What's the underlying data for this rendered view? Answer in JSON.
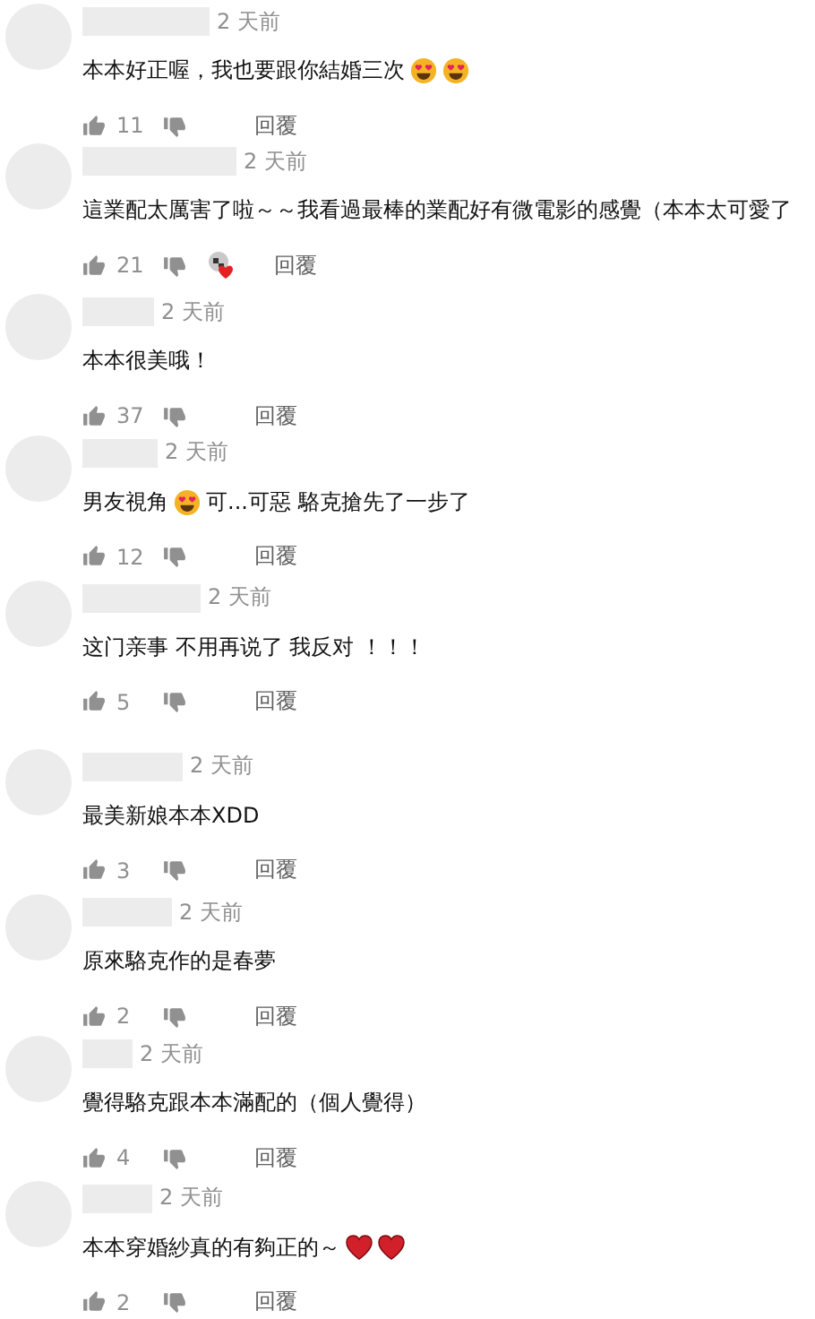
{
  "comments": [
    {
      "time": "2 天前",
      "body": [
        {
          "kind": "text",
          "text": "本本好正喔，我也要跟你結婚三次"
        },
        {
          "kind": "heart_eyes"
        },
        {
          "kind": "heart_eyes"
        }
      ],
      "likes": "11",
      "hearted": false,
      "reply": "回覆"
    },
    {
      "time": "2 天前",
      "body": [
        {
          "kind": "text",
          "text": "這業配太厲害了啦～～我看過最棒的業配好有微電影的感覺（本本太可愛了"
        }
      ],
      "likes": "21",
      "hearted": true,
      "reply": "回覆"
    },
    {
      "time": "2 天前",
      "body": [
        {
          "kind": "text",
          "text": "本本很美哦！"
        }
      ],
      "likes": "37",
      "hearted": false,
      "reply": "回覆"
    },
    {
      "time": "2 天前",
      "body": [
        {
          "kind": "text",
          "text": "男友視角"
        },
        {
          "kind": "heart_eyes"
        },
        {
          "kind": "text",
          "text": "可...可惡 駱克搶先了一步了"
        }
      ],
      "likes": "12",
      "hearted": false,
      "reply": "回覆"
    },
    {
      "time": "2 天前",
      "body": [
        {
          "kind": "text",
          "text": "这门亲事 不用再说了 我反对 ！！！"
        }
      ],
      "likes": "5",
      "hearted": false,
      "reply": "回覆"
    },
    {
      "time": "2 天前",
      "body": [
        {
          "kind": "text",
          "text": "最美新娘本本XDD"
        }
      ],
      "likes": "3",
      "hearted": false,
      "reply": "回覆"
    },
    {
      "time": "2 天前",
      "body": [
        {
          "kind": "text",
          "text": "原來駱克作的是春夢"
        }
      ],
      "likes": "2",
      "hearted": false,
      "reply": "回覆"
    },
    {
      "time": "2 天前",
      "body": [
        {
          "kind": "text",
          "text": "覺得駱克跟本本滿配的（個人覺得）"
        }
      ],
      "likes": "4",
      "hearted": false,
      "reply": "回覆"
    },
    {
      "time": "2 天前",
      "body": [
        {
          "kind": "text",
          "text": "本本穿婚紗真的有夠正的～"
        },
        {
          "kind": "heart"
        },
        {
          "kind": "heart"
        }
      ],
      "likes": "2",
      "hearted": false,
      "reply": "回覆"
    }
  ]
}
